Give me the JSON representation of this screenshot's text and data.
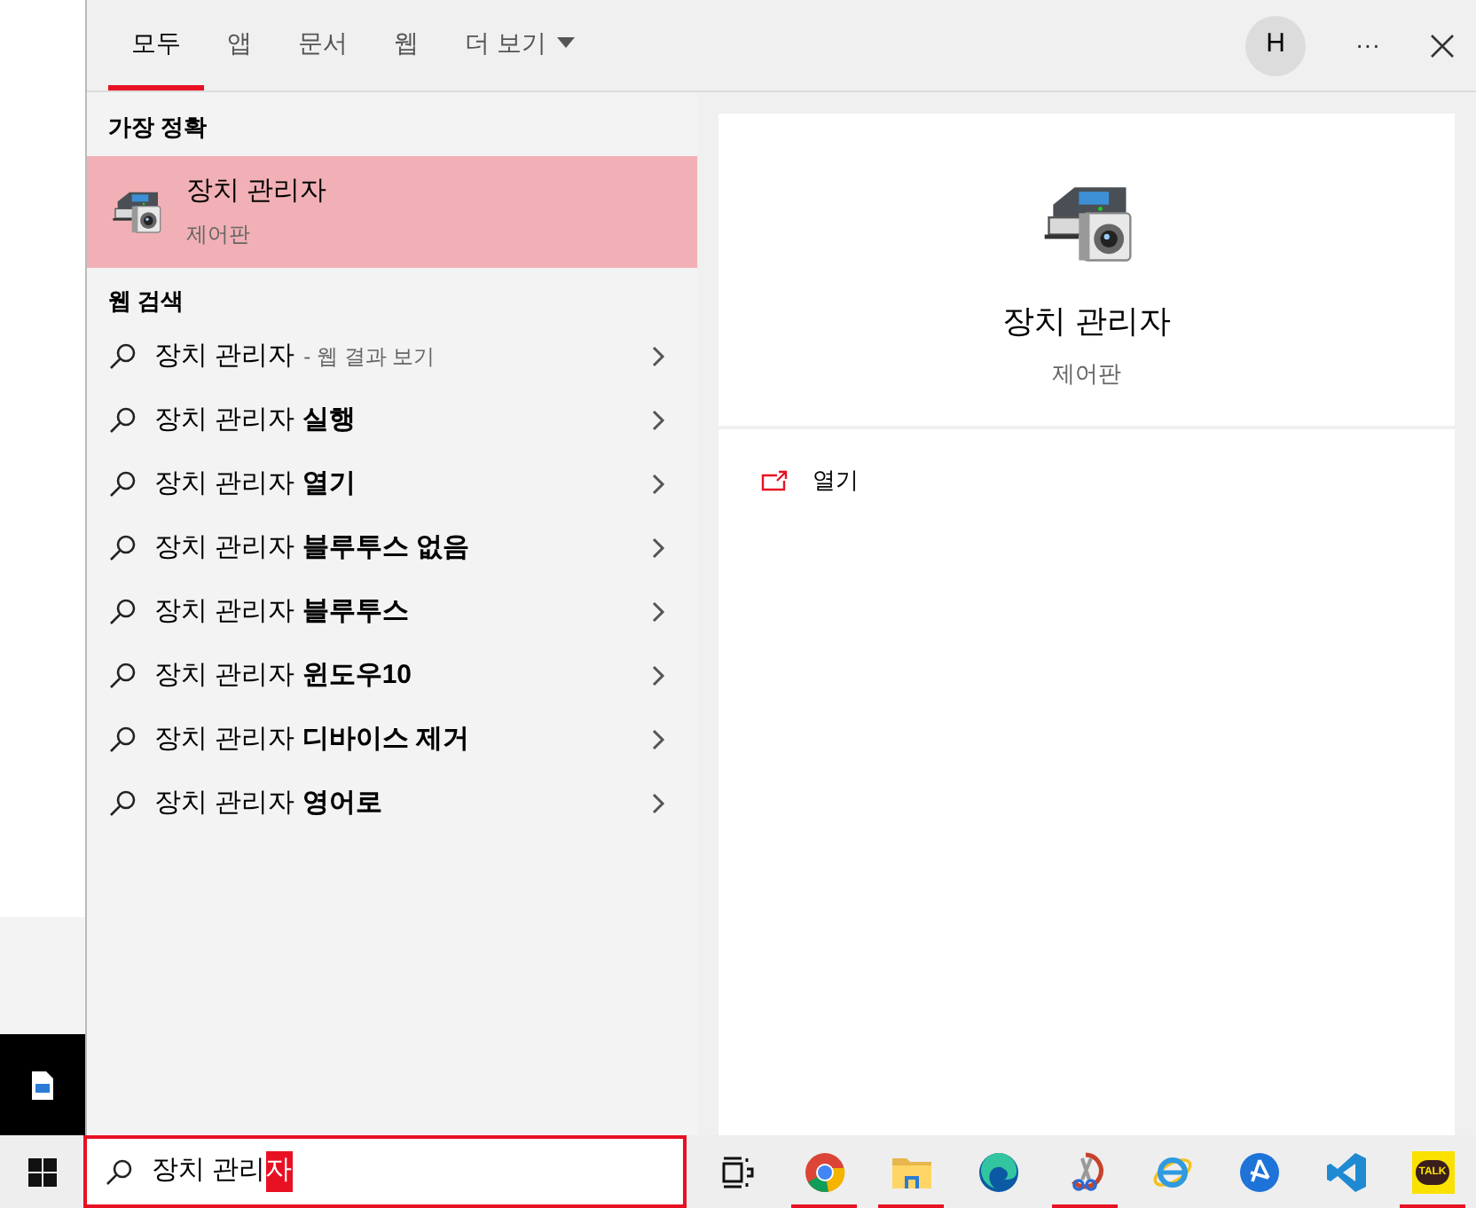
{
  "tabs": [
    {
      "label": "모두",
      "selected": true
    },
    {
      "label": "앱",
      "selected": false
    },
    {
      "label": "문서",
      "selected": false
    },
    {
      "label": "웹",
      "selected": false
    },
    {
      "label": "더 보기",
      "selected": false,
      "kind": "dropdown"
    }
  ],
  "account": {
    "initial": "H"
  },
  "more_button": "···",
  "best_match": {
    "heading": "가장 정확",
    "title": "장치 관리자",
    "subtitle": "제어판",
    "selected": true
  },
  "web_search": {
    "heading": "웹 검색",
    "items": [
      {
        "kind": "hint",
        "text": "장치 관리자",
        "note": "- 웹 결과 보기"
      },
      {
        "kind": "suggestion",
        "text": "장치 관리자 **실행**"
      },
      {
        "kind": "suggestion",
        "text": "장치 관리자 **열기**"
      },
      {
        "kind": "suggestion",
        "text": "장치 관리자 **블루투스 없음**"
      },
      {
        "kind": "suggestion",
        "text": "장치 관리자 **블루투스**"
      },
      {
        "kind": "suggestion",
        "text": "장치 관리자 **윈도우10**"
      },
      {
        "kind": "suggestion",
        "text": "장치 관리자 **디바이스 제거**"
      },
      {
        "kind": "suggestion",
        "text": "장치 관리자 **영어로**"
      }
    ]
  },
  "preview": {
    "title": "장치 관리자",
    "subtitle": "제어판",
    "actions": [
      {
        "label": "열기"
      }
    ]
  },
  "search": {
    "value": "장치 관리",
    "composing": "자"
  },
  "taskbar": [
    {
      "kind": "taskview",
      "running": false
    },
    {
      "kind": "chrome",
      "running": true
    },
    {
      "kind": "explorer",
      "running": true
    },
    {
      "kind": "edge",
      "running": false
    },
    {
      "kind": "snip",
      "running": true
    },
    {
      "kind": "ie",
      "running": false
    },
    {
      "kind": "blueapp",
      "running": false
    },
    {
      "kind": "vscode",
      "running": false
    },
    {
      "kind": "kakao",
      "running": true,
      "label": "TALK"
    }
  ]
}
